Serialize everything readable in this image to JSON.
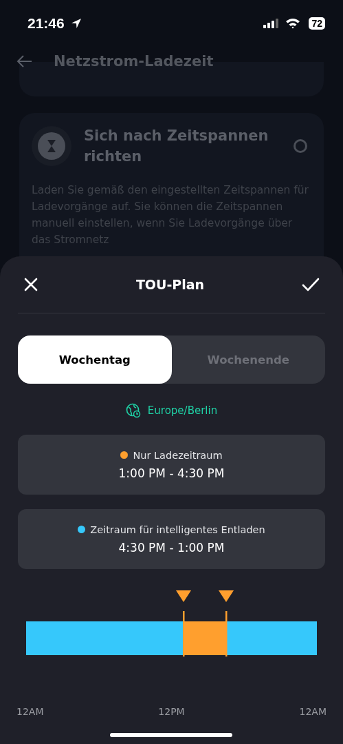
{
  "status_bar": {
    "time": "21:46",
    "battery": "72"
  },
  "page": {
    "title": "Netzstrom-Ladezeit"
  },
  "option": {
    "title": "Sich nach Zeitspannen richten",
    "selected": false,
    "description": "Laden Sie gemäß den eingestellten Zeitspannen für Ladevorgänge auf. Sie können die Zeitspannen manuell einstellen, wenn Sie Ladevorgänge über das Stromnetz"
  },
  "sheet": {
    "title": "TOU-Plan",
    "tabs": [
      {
        "label": "Wochentag",
        "selected": true
      },
      {
        "label": "Wochenende",
        "selected": false
      }
    ],
    "timezone": "Europe/Berlin",
    "periods": [
      {
        "kind": "charge",
        "name": "Nur Ladezeitraum",
        "range": "1:00 PM - 4:30 PM",
        "color": "#ff9f2e"
      },
      {
        "kind": "discharge",
        "name": "Zeitraum für intelligentes Entladen",
        "range": "4:30 PM - 1:00 PM",
        "color": "#36c8fb"
      }
    ],
    "timeline": {
      "handles": [
        {
          "level": 0.5417
        },
        {
          "level": 0.6875
        }
      ],
      "ticks": [
        "12AM",
        "12PM",
        "12AM"
      ]
    }
  }
}
